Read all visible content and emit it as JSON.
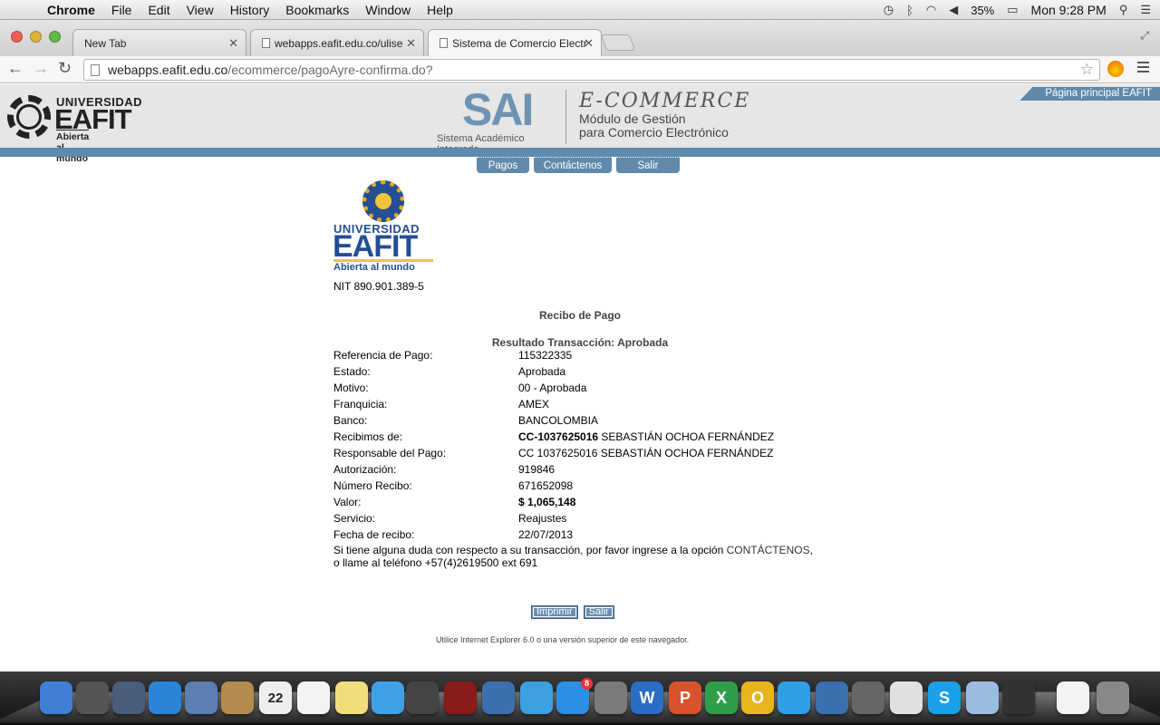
{
  "menubar": {
    "app": "Chrome",
    "items": [
      "File",
      "Edit",
      "View",
      "History",
      "Bookmarks",
      "Window",
      "Help"
    ],
    "battery": "35%",
    "clock": "Mon 9:28 PM"
  },
  "tabs": [
    {
      "label": "New Tab"
    },
    {
      "label": "webapps.eafit.edu.co/ulise"
    },
    {
      "label": "Sistema de Comercio Electr"
    }
  ],
  "address": {
    "host": "webapps.eafit.edu.co",
    "path": "/ecommerce/pagoAyre-confirma.do?"
  },
  "header": {
    "logo_top": "UNIVERSIDAD",
    "logo_main": "EAFIT",
    "logo_sub": "Abierta al mundo",
    "sai": "SAI",
    "sai_sub": "Sistema Académico Integrado",
    "ecommerce": "E-COMMERCE",
    "modulo1": "Módulo de Gestión",
    "modulo2": "para Comercio Electrónico",
    "principal": "Página principal EAFIT"
  },
  "nav": [
    "Pagos",
    "Contáctenos",
    "Salir"
  ],
  "receipt": {
    "emblem_top": "UNIVERSIDAD",
    "emblem_main": "EAFIT",
    "emblem_sub": "Abierta al mundo",
    "nit": "NIT 890.901.389-5",
    "title": "Recibo de Pago",
    "result": "Resultado Transacción: Aprobada",
    "rows": [
      {
        "k": "Referencia de Pago:",
        "v": "115322335"
      },
      {
        "k": "Estado:",
        "v": "Aprobada"
      },
      {
        "k": "Motivo:",
        "v": "00 - Aprobada"
      },
      {
        "k": "Franquicia:",
        "v": "AMEX"
      },
      {
        "k": "Banco:",
        "v": "BANCOLOMBIA"
      },
      {
        "k": "Recibimos de:",
        "vb": "CC-1037625016",
        "v": " SEBASTIÁN OCHOA FERNÁNDEZ"
      },
      {
        "k": "Responsable del Pago:",
        "v": "CC 1037625016 SEBASTIÁN OCHOA FERNÁNDEZ"
      },
      {
        "k": "Autorización:",
        "v": "919846"
      },
      {
        "k": "Número Recibo:",
        "v": "671652098"
      },
      {
        "k": "Valor:",
        "vb": "$ 1,065,148",
        "v": ""
      },
      {
        "k": "Servicio:",
        "v": "Reajustes"
      },
      {
        "k": "Fecha de recibo:",
        "v": "22/07/2013"
      }
    ],
    "note_a": "Si tiene alguna duda con respecto a su transacción, por favor ingrese a la opción ",
    "note_link": "CONTÁCTENOS",
    "note_b": ",",
    "note_c": "o llame al teléfono +57(4)2619500 ext 691",
    "btn_print": "Imprimir",
    "btn_exit": "Salir",
    "footer": "Utilice Internet Explorer 6.0 o una versión superior de este navegador."
  },
  "dock": [
    "Finder",
    "Launchpad",
    "Mission Control",
    "Safari",
    "Mail",
    "Contacts",
    "Calendar",
    "Reminders",
    "Notes",
    "Messages",
    "FaceTime",
    "Photo Booth",
    "iPhoto",
    "iTunes",
    "App Store",
    "System Preferences",
    "Word",
    "PowerPoint",
    "Excel",
    "Outlook",
    "Messenger",
    "Network",
    "Dashboard",
    "Chrome",
    "Skype",
    "VirtualBox",
    "X11",
    "Documents",
    "Trash"
  ],
  "calendar_day": "22",
  "appstore_badge": "8"
}
